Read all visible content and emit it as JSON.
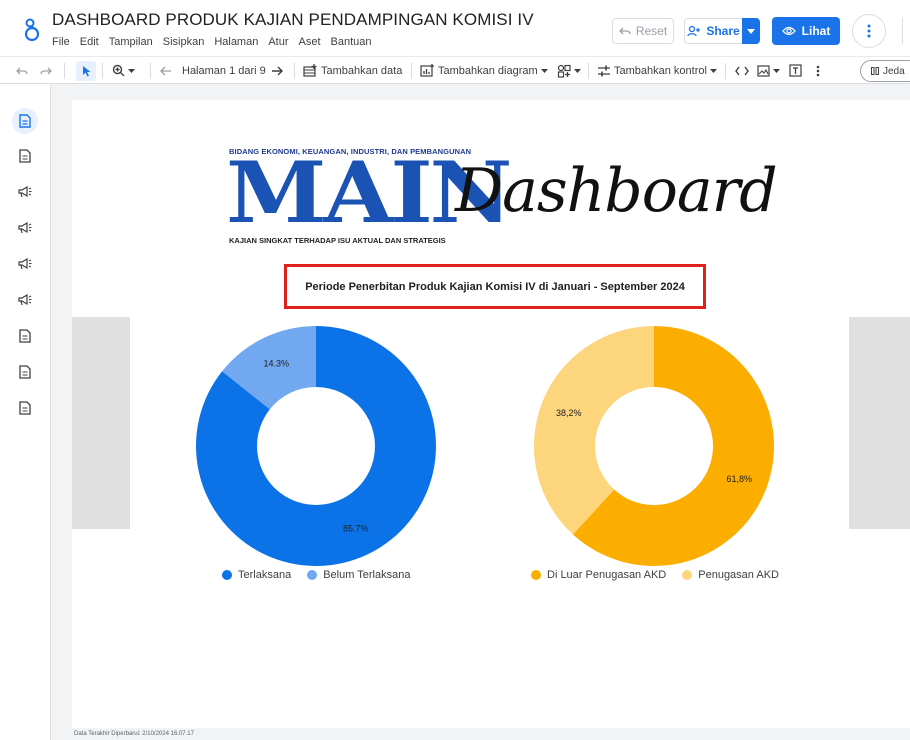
{
  "app": {
    "doc_title": "DASHBOARD PRODUK KAJIAN PENDAMPINGAN KOMISI IV",
    "menu": [
      "File",
      "Edit",
      "Tampilan",
      "Sisipkan",
      "Halaman",
      "Atur",
      "Aset",
      "Bantuan"
    ],
    "buttons": {
      "reset": "Reset",
      "share": "Share",
      "view": "Lihat"
    }
  },
  "toolbar": {
    "page_indicator": "Halaman 1 dari 9",
    "add_data": "Tambahkan data",
    "add_chart": "Tambahkan diagram",
    "add_control": "Tambahkan kontrol",
    "pill": "Jeda"
  },
  "rail": {
    "icons": [
      "page-icon",
      "page-icon",
      "megaphone-icon",
      "megaphone-icon",
      "megaphone-icon",
      "megaphone-icon",
      "page-icon",
      "page-icon",
      "page-icon"
    ],
    "accent": "#1a73e8"
  },
  "report": {
    "kicker": "BIDANG EKONOMI, KEUANGAN, INDUSTRI, DAN PEMBANGUNAN",
    "logo_main": "MAIN",
    "logo_script": "Dashboard",
    "tagline": "KAJIAN SINGKAT TERHADAP ISU AKTUAL DAN STRATEGIS",
    "period": "Periode Penerbitan Produk Kajian Komisi IV di Januari - September 2024",
    "footer": "Data Terakhir Diperbarui: 2/10/2024 16.07.17"
  },
  "chart_data": [
    {
      "type": "pie",
      "donut": true,
      "categories": [
        "Terlaksana",
        "Belum Terlaksana"
      ],
      "values": [
        85.7,
        14.3
      ],
      "labels": [
        "85.7%",
        "14.3%"
      ],
      "colors": [
        "#0b72e7",
        "#71a8f0"
      ],
      "legend": "bottom"
    },
    {
      "type": "pie",
      "donut": true,
      "categories": [
        "Di Luar Penugasan AKD",
        "Penugasan AKD"
      ],
      "values": [
        61.8,
        38.2
      ],
      "labels": [
        "61,8%",
        "38,2%"
      ],
      "colors": [
        "#fbad00",
        "#fdd57c"
      ],
      "legend": "bottom"
    }
  ]
}
